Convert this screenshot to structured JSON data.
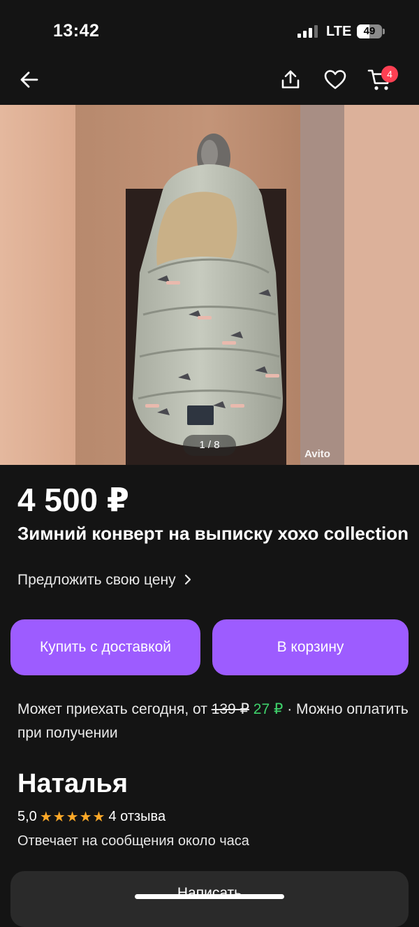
{
  "status_bar": {
    "time": "13:42",
    "network": "LTE",
    "battery": "49",
    "battery_level": 0.49
  },
  "header": {
    "back_icon": "arrow-left-icon",
    "share_icon": "share-icon",
    "favorite_icon": "heart-icon",
    "cart_icon": "cart-icon",
    "cart_count": "4"
  },
  "gallery": {
    "counter": "1 / 8",
    "watermark": "Avito"
  },
  "listing": {
    "price": "4 500 ₽",
    "title": "Зимний конверт на выписку хохо collection",
    "offer_price_link": "Предложить свою цену",
    "label_text": "XoXo collection"
  },
  "actions": {
    "buy_with_delivery": "Купить с доставкой",
    "add_to_cart": "В корзину"
  },
  "delivery": {
    "text_prefix": "Может приехать сегодня, от",
    "old_price": "139 ₽",
    "new_price": "27 ₽",
    "text_suffix": "· Можно оплатить при получении"
  },
  "seller": {
    "name": "Наталья",
    "rating": "5,0",
    "stars": 5,
    "reviews": "4 отзыва",
    "response_time": "Отвечает на сообщения около часа",
    "write_button": "Написать"
  },
  "colors": {
    "accent": "#9d5cff",
    "badge": "#ff4053",
    "discount_price": "#3fd26b",
    "star": "#ffa928",
    "background": "#141414"
  }
}
